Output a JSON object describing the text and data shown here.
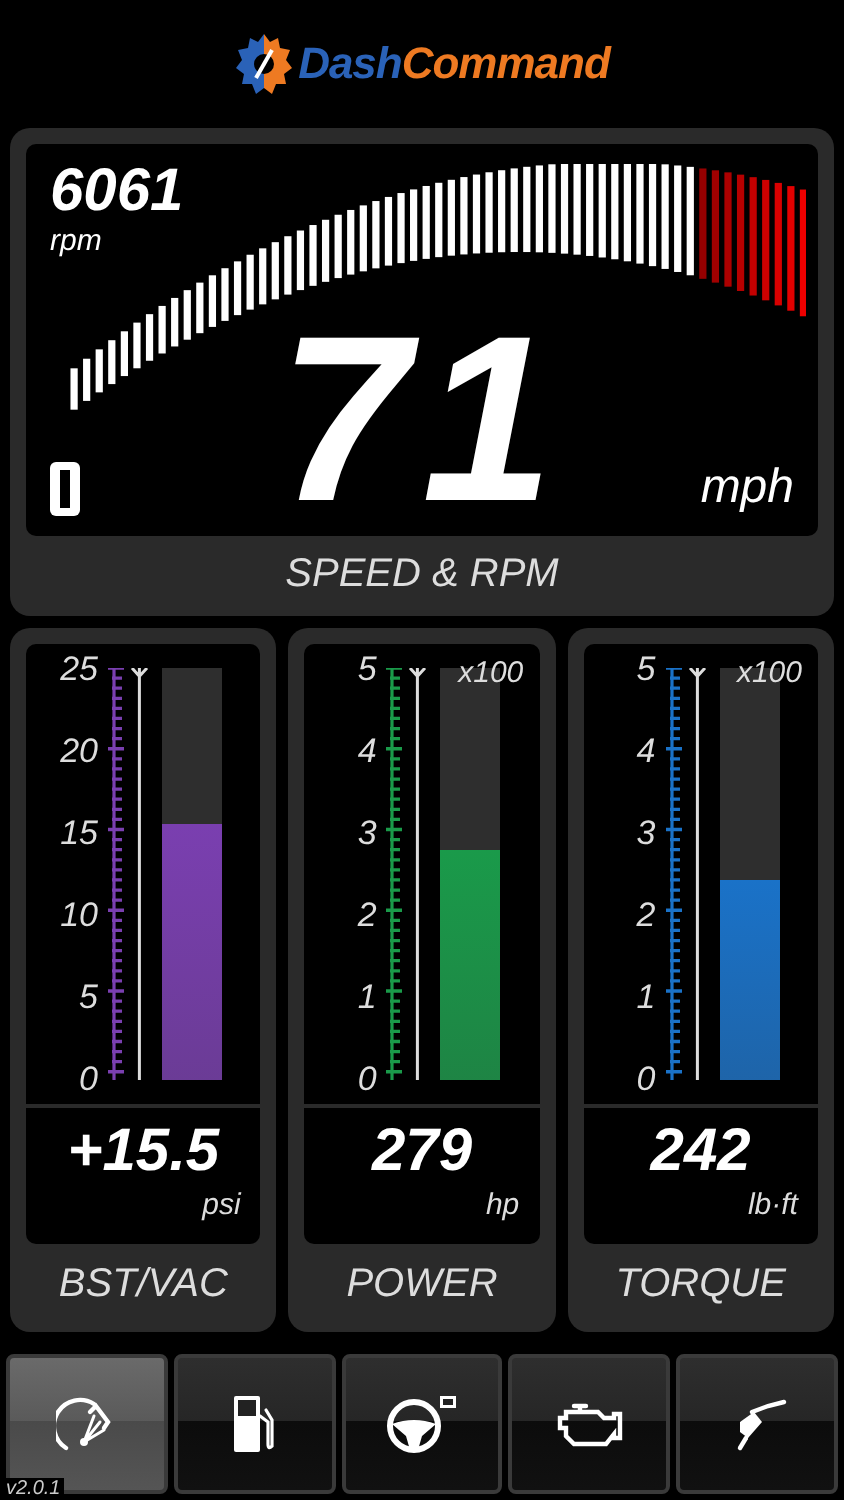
{
  "logo": {
    "part_1": "Dash",
    "part_2": "Command"
  },
  "speed_panel": {
    "rpm": "6061",
    "rpm_unit": "rpm",
    "speed": "71",
    "speed_unit": "mph",
    "label": "SPEED & RPM"
  },
  "gauges": [
    {
      "label": "BST/VAC",
      "value": "+15.5",
      "unit": "psi",
      "level": 0.62,
      "color": "#7a3fb0",
      "ticks": [
        "25",
        "20",
        "15",
        "10",
        "5",
        "0"
      ]
    },
    {
      "label": "POWER",
      "value": "279",
      "unit": "hp",
      "level": 0.558,
      "color": "#1a9a4a",
      "multiplier": "x100",
      "ticks": [
        "5",
        "4",
        "3",
        "2",
        "1",
        "0"
      ]
    },
    {
      "label": "TORQUE",
      "value": "242",
      "unit": "lb·ft",
      "level": 0.484,
      "color": "#1a72c8",
      "multiplier": "x100",
      "ticks": [
        "5",
        "4",
        "3",
        "2",
        "1",
        "0"
      ]
    }
  ],
  "tabs": [
    {
      "kind": "gauge",
      "selected": true
    },
    {
      "kind": "fuel",
      "selected": false
    },
    {
      "kind": "steering",
      "selected": false
    },
    {
      "kind": "engine",
      "selected": false
    },
    {
      "kind": "nozzle",
      "selected": false
    }
  ],
  "version": "v2.0.1"
}
